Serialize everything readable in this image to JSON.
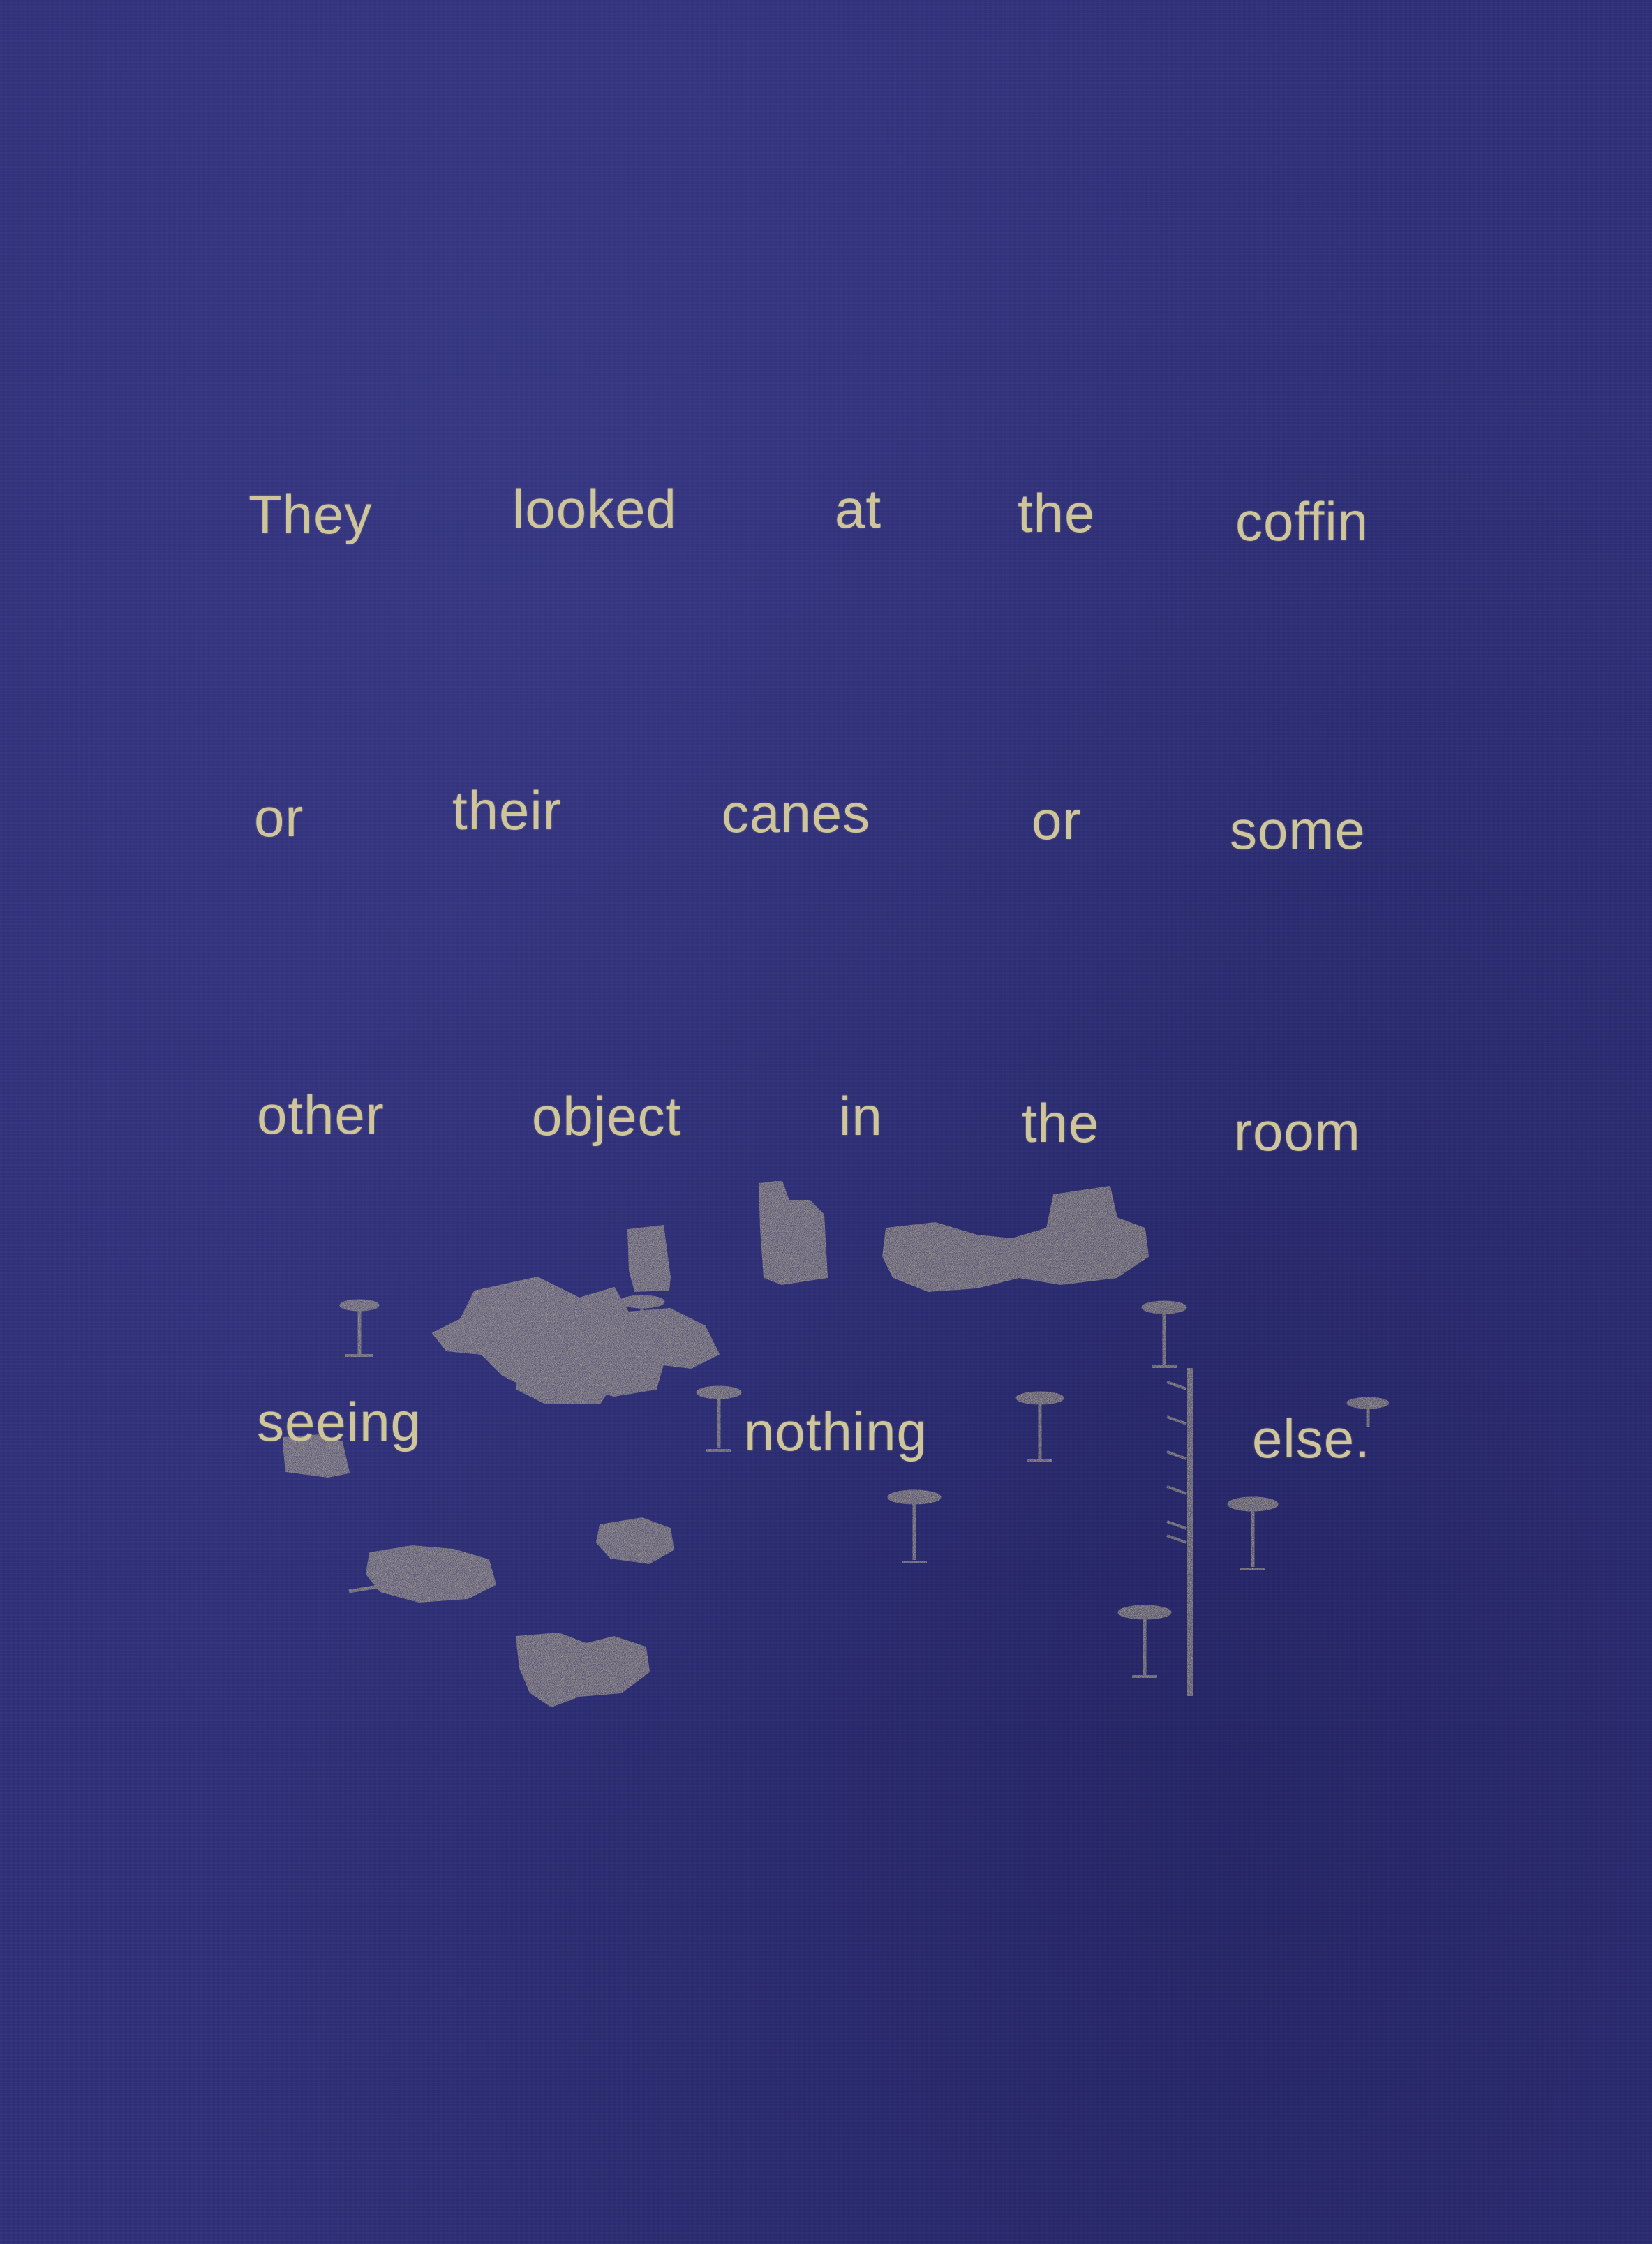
{
  "print": {
    "background_color": "#2f3079",
    "ink_color": "#cfc59a",
    "lines": [
      [
        "They",
        "looked",
        "at",
        "the",
        "coffin"
      ],
      [
        "or",
        "their",
        "canes",
        "or",
        "some"
      ],
      [
        "other",
        "object",
        "in",
        "the",
        "room"
      ],
      [
        "seeing",
        "nothing",
        "else."
      ]
    ]
  }
}
